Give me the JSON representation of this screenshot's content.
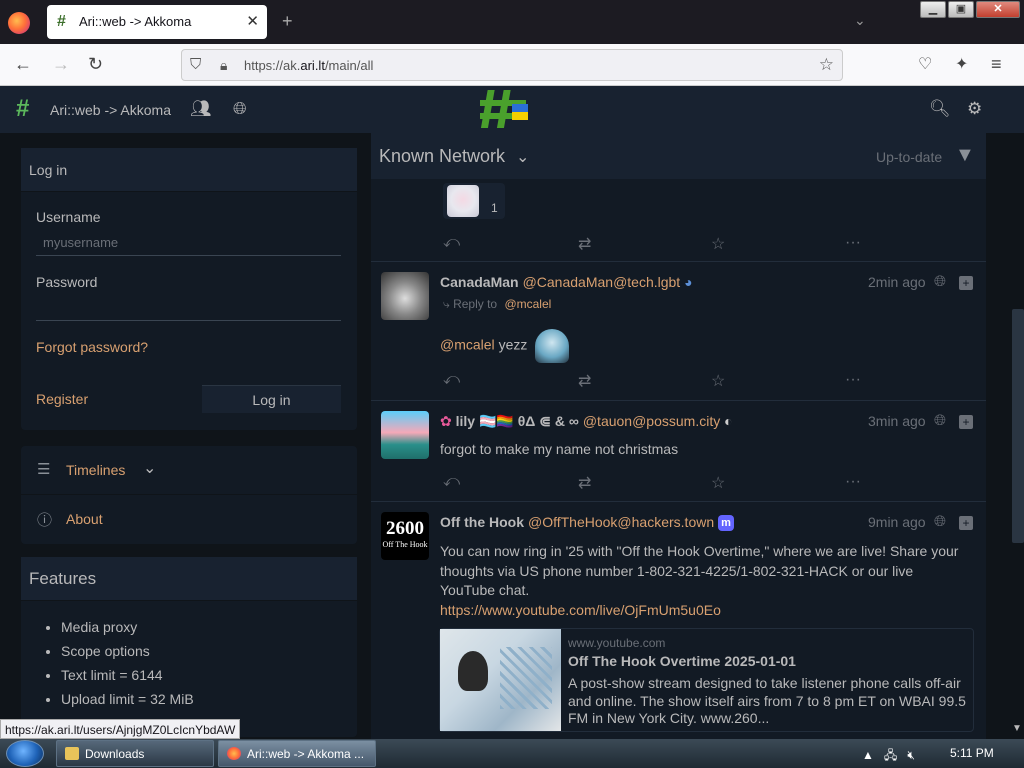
{
  "browser": {
    "tab_title": "Ari::web -> Akkoma",
    "tab_close": "✕",
    "new_tab": "+",
    "url_prefix": "https://ak.",
    "url_domain": "ari.lt",
    "url_path": "/main/all",
    "status_url": "https://ak.ari.lt/users/AjnjgMZ0LcIcnYbdAW"
  },
  "appnav": {
    "site_name": "Ari::web -> Akkoma"
  },
  "login": {
    "header": "Log in",
    "username_label": "Username",
    "username_placeholder": "myusername",
    "password_label": "Password",
    "forgot": "Forgot password?",
    "register": "Register",
    "login_button": "Log in"
  },
  "nav": {
    "timelines": "Timelines",
    "about": "About"
  },
  "features": {
    "header": "Features",
    "items": [
      "Media proxy",
      "Scope options",
      "Text limit = 6144",
      "Upload limit = 32 MiB"
    ]
  },
  "timeline": {
    "title": "Known Network",
    "up_to_date": "Up-to-date",
    "reaction_count": "1",
    "statuses": [
      {
        "name": "CanadaMan",
        "handle": "@CanadaMan@tech.lgbt",
        "time": "2min ago",
        "reply_label": "Reply to",
        "reply_to": "@mcalel",
        "mention": "@mcalel",
        "text": "yezz"
      },
      {
        "name": "lily 🏳️‍⚧️🏳️‍🌈 θΔ ⋐ & ∞",
        "handle": "@tauon@possum.city",
        "time": "3min ago",
        "text": "forgot to make my name not christmas"
      },
      {
        "name": "Off the Hook",
        "handle": "@OffTheHook@hackers.town",
        "time": "9min ago",
        "text": "You can now ring in '25 with \"Off the Hook Overtime,\" where we are live! Share your thoughts via US phone number 1-802-321-4225/1-802-321-HACK or our live YouTube chat.",
        "link": "https://www.youtube.com/live/OjFmUm5u0Eo",
        "avatar_text": "2600",
        "avatar_sub": "Off The Hook",
        "card": {
          "domain": "www.youtube.com",
          "title": "Off The Hook Overtime 2025-01-01",
          "description": "A post-show stream designed to take listener phone calls off-air and online. The show itself airs from 7 to 8 pm ET on WBAI 99.5 FM in New York City. www.260..."
        }
      }
    ]
  },
  "taskbar": {
    "downloads": "Downloads",
    "firefox": "Ari::web -> Akkoma ...",
    "clock": "5:11 PM"
  },
  "colors": {
    "background": "#0f1419",
    "panel": "#121a24",
    "header": "#182230",
    "link": "#d8a070",
    "text": "#b9b9ba"
  }
}
